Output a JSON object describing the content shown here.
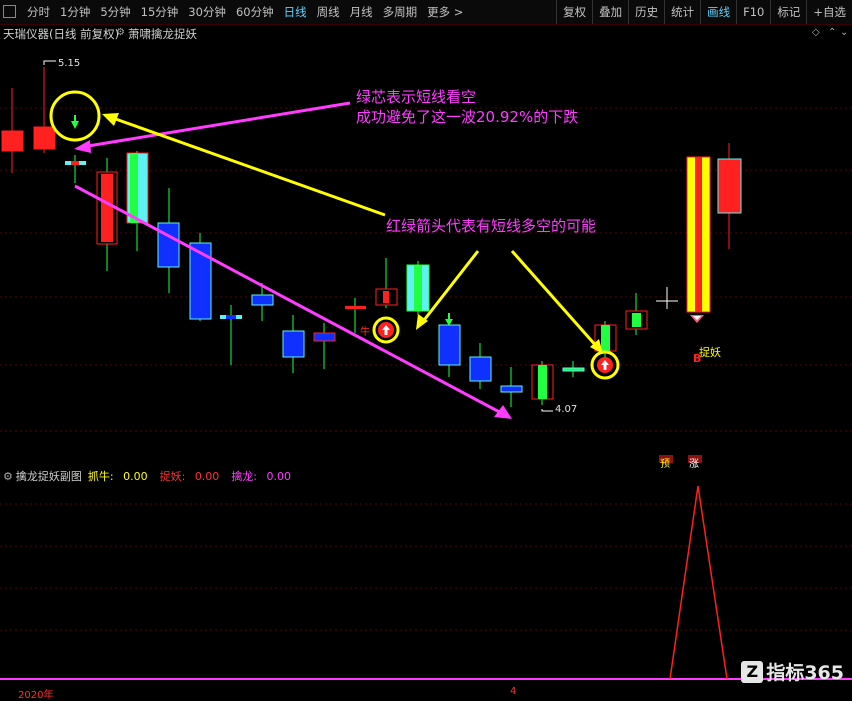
{
  "toolbar": {
    "periods": [
      "分时",
      "1分钟",
      "5分钟",
      "15分钟",
      "30分钟",
      "60分钟",
      "日线",
      "周线",
      "月线",
      "多周期",
      "更多"
    ],
    "more_arrow": ">",
    "active_period": "日线",
    "right_tabs": [
      "复权",
      "叠加",
      "历史",
      "统计",
      "画线",
      "F10",
      "标记",
      "+自选"
    ],
    "active_right": "画线"
  },
  "titlebar": {
    "instrument": "天瑞仪器(日线 前复权)",
    "indicator_name": "萧啸擒龙捉妖"
  },
  "main_chart": {
    "high_label": "5.15",
    "low_label": "4.07",
    "annotation1_line1": "绿芯表示短线看空",
    "annotation1_line2": "成功避免了这一波20.92%的下跌",
    "annotation2": "红绿箭头代表有短线多空的可能",
    "small_label_niu": "牛",
    "zhuoyao_label": "捉妖",
    "b_label": "B",
    "yu_label": "预",
    "zhang_label": "涨"
  },
  "sub_panel": {
    "title": "擒龙捉妖副图",
    "fields": [
      {
        "label": "抓牛:",
        "value": "0.00",
        "color": "#ffff00"
      },
      {
        "label": "捉妖:",
        "value": "0.00",
        "color": "#ff3030"
      },
      {
        "label": "擒龙:",
        "value": "0.00",
        "color": "#ff3cff"
      }
    ]
  },
  "xaxis": {
    "start_label": "2020年",
    "mid_label": "4"
  },
  "watermark": {
    "logo": "Z",
    "text": "指标365"
  },
  "colors": {
    "up": "#ff2020",
    "down_cyan": "#5ef2f2",
    "down_blue": "#1030ff",
    "green": "#20ff40",
    "yellow": "#ffff00",
    "magenta": "#ff3cff"
  }
}
